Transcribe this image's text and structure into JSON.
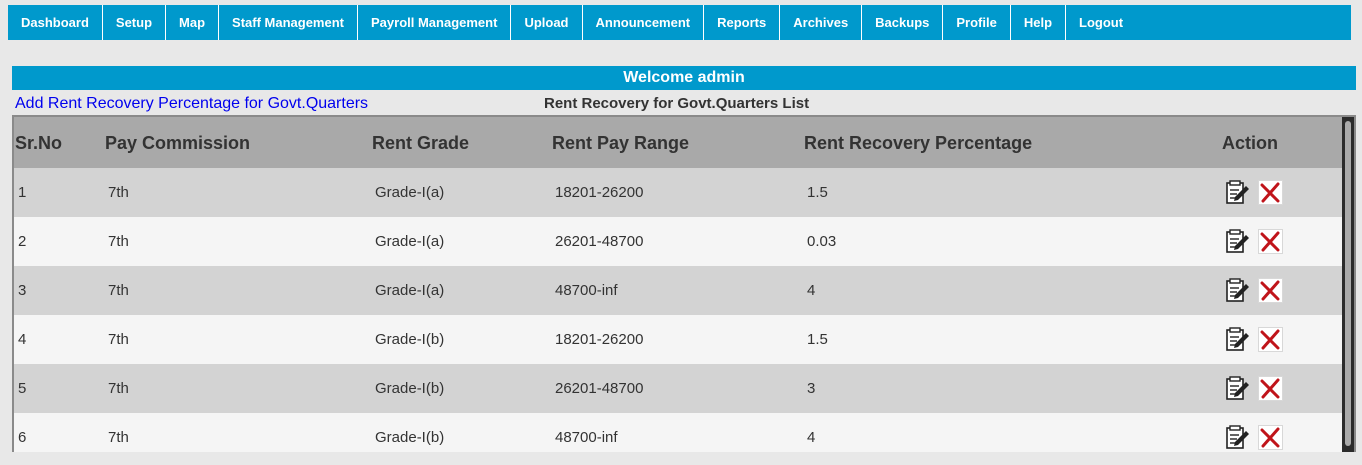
{
  "nav": {
    "items": [
      {
        "label": "Dashboard",
        "name": "nav-dashboard"
      },
      {
        "label": "Setup",
        "name": "nav-setup"
      },
      {
        "label": "Map",
        "name": "nav-map"
      },
      {
        "label": "Staff Management",
        "name": "nav-staff-management"
      },
      {
        "label": "Payroll Management",
        "name": "nav-payroll-management"
      },
      {
        "label": "Upload",
        "name": "nav-upload"
      },
      {
        "label": "Announcement",
        "name": "nav-announcement"
      },
      {
        "label": "Reports",
        "name": "nav-reports"
      },
      {
        "label": "Archives",
        "name": "nav-archives"
      },
      {
        "label": "Backups",
        "name": "nav-backups"
      },
      {
        "label": "Profile",
        "name": "nav-profile"
      },
      {
        "label": "Help",
        "name": "nav-help"
      },
      {
        "label": "Logout",
        "name": "nav-logout"
      }
    ]
  },
  "welcome": "Welcome admin",
  "add_link": "Add Rent Recovery Percentage for Govt.Quarters",
  "list_title": "Rent Recovery for Govt.Quarters List",
  "table": {
    "headers": {
      "srno": "Sr.No",
      "pay_commission": "Pay Commission",
      "rent_grade": "Rent Grade",
      "pay_range": "Rent Pay Range",
      "percentage": "Rent Recovery Percentage",
      "action": "Action"
    },
    "rows": [
      {
        "srno": "1",
        "pay_commission": "7th",
        "rent_grade": "Grade-I(a)",
        "pay_range": "18201-26200",
        "percentage": "1.5"
      },
      {
        "srno": "2",
        "pay_commission": "7th",
        "rent_grade": "Grade-I(a)",
        "pay_range": "26201-48700",
        "percentage": "0.03"
      },
      {
        "srno": "3",
        "pay_commission": "7th",
        "rent_grade": "Grade-I(a)",
        "pay_range": "48700-inf",
        "percentage": "4"
      },
      {
        "srno": "4",
        "pay_commission": "7th",
        "rent_grade": "Grade-I(b)",
        "pay_range": "18201-26200",
        "percentage": "1.5"
      },
      {
        "srno": "5",
        "pay_commission": "7th",
        "rent_grade": "Grade-I(b)",
        "pay_range": "26201-48700",
        "percentage": "3"
      },
      {
        "srno": "6",
        "pay_commission": "7th",
        "rent_grade": "Grade-I(b)",
        "pay_range": "48700-inf",
        "percentage": "4"
      }
    ],
    "action_icons": {
      "edit": "edit-icon",
      "delete": "delete-icon"
    }
  }
}
